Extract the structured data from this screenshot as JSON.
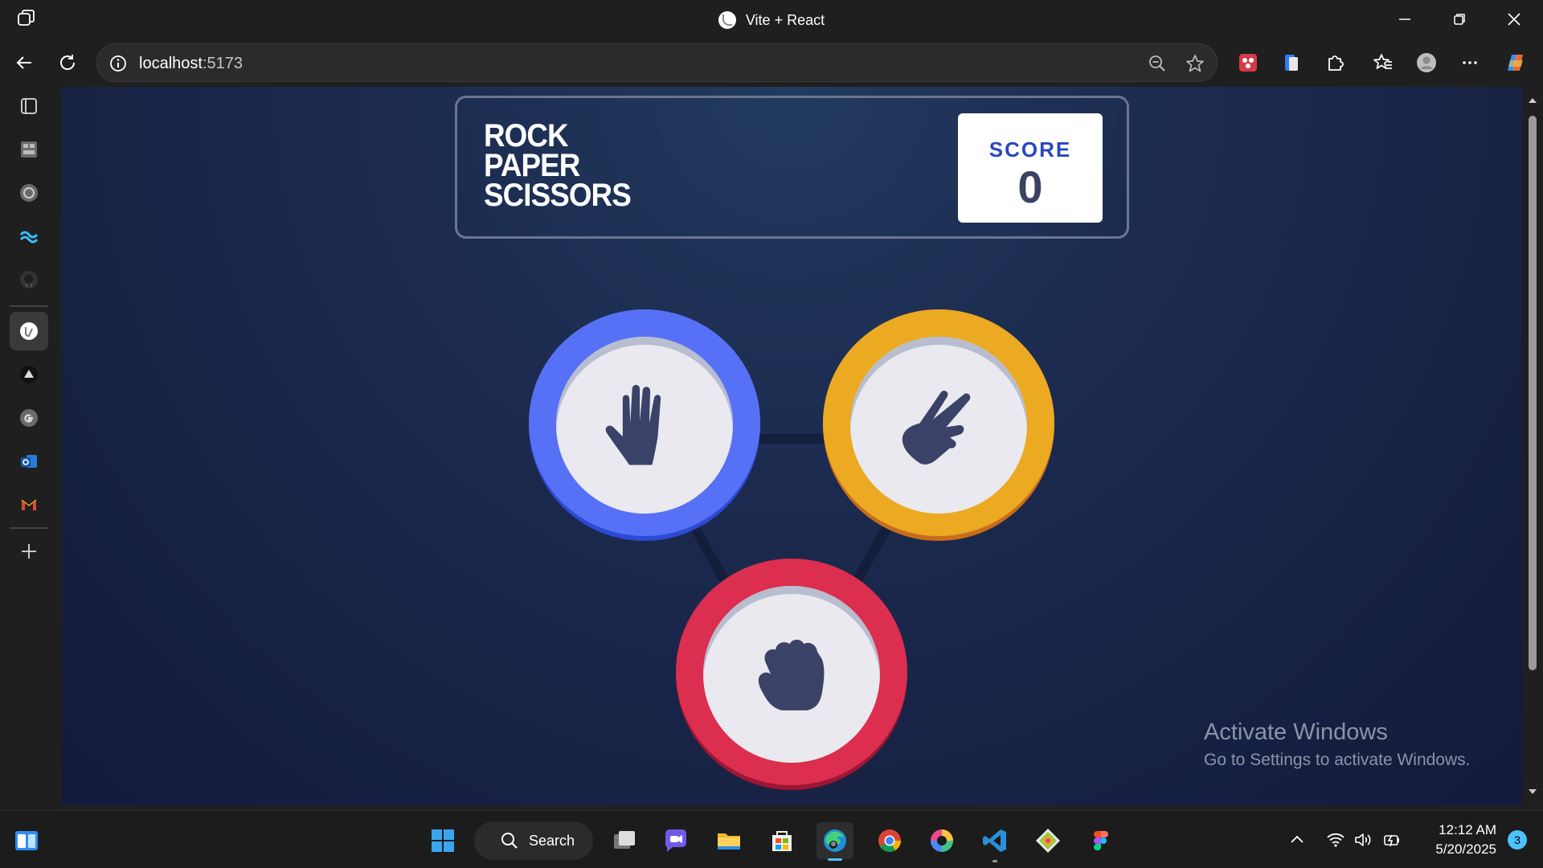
{
  "window": {
    "title": "Vite + React"
  },
  "browser": {
    "url_host": "localhost",
    "url_port": ":5173"
  },
  "sidebar": {
    "items": [
      "tab-actions-icon",
      "collections-icon",
      "openai-icon",
      "tailwind-icon",
      "github-icon",
      "vite-react-icon",
      "vercel-icon",
      "google-icon",
      "outlook-icon",
      "gmail-icon"
    ],
    "add_label": "+"
  },
  "game": {
    "logo_lines": [
      "ROCK",
      "PAPER",
      "SCISSORS"
    ],
    "score_label": "SCORE",
    "score_value": "0",
    "choices": [
      {
        "name": "paper",
        "color": "#5671f5"
      },
      {
        "name": "scissors",
        "color": "#eca922"
      },
      {
        "name": "rock",
        "color": "#dc2e4e"
      }
    ]
  },
  "watermark": {
    "title": "Activate Windows",
    "subtitle": "Go to Settings to activate Windows."
  },
  "taskbar": {
    "search_label": "Search",
    "time": "12:12 AM",
    "date": "5/20/2025",
    "notification_count": "3"
  },
  "colors": {
    "bg_top": "#223a5f",
    "bg_bottom": "#141a3b",
    "score_label": "#2a46c0",
    "score_value": "#3b4363"
  }
}
